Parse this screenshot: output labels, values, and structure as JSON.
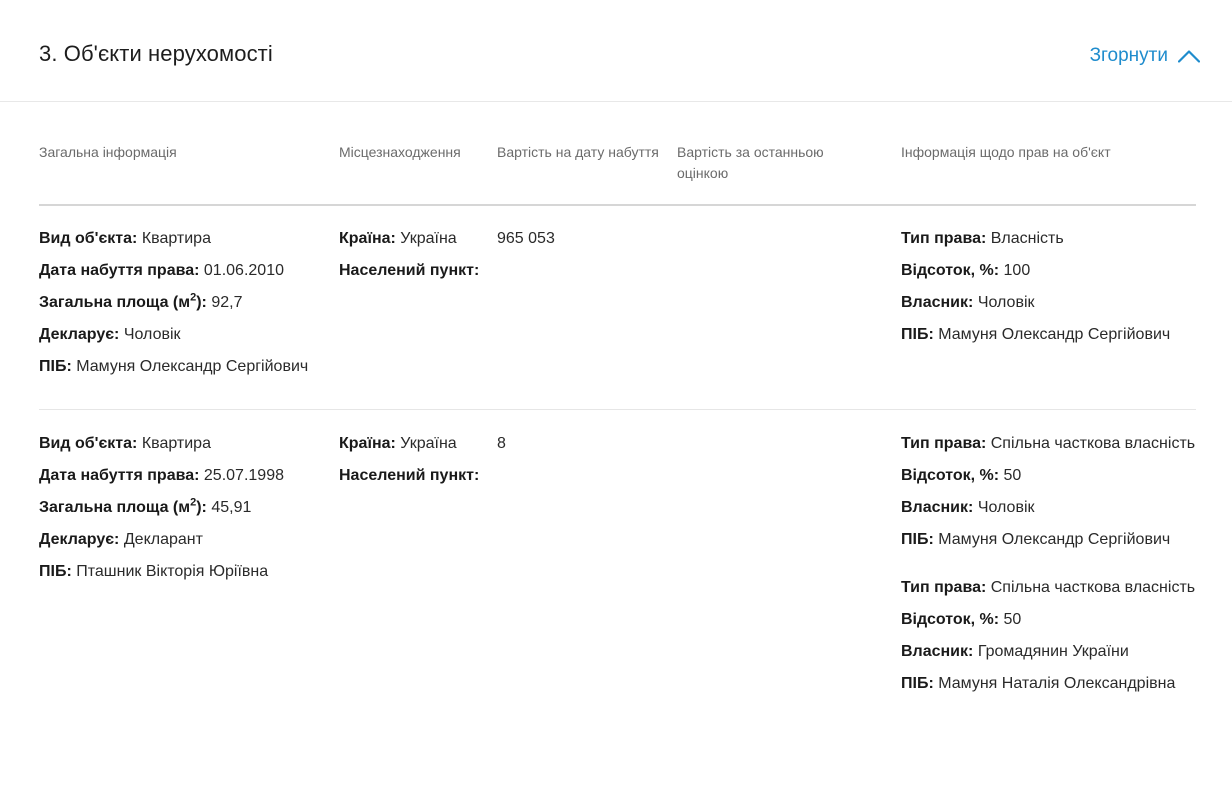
{
  "section": {
    "title": "3. Об'єкти нерухомості",
    "toggle_label": "Згорнути"
  },
  "columns": [
    "Загальна інформація",
    "Місцезнаходження",
    "Вартість на дату набуття",
    "Вартість за останньою оцінкою",
    "Інформація щодо прав на об'єкт"
  ],
  "labels": {
    "object_type": "Вид об'єкта:",
    "acquisition_date": "Дата набуття права:",
    "area_prefix": "Загальна площа (м",
    "area_sup": "2",
    "area_suffix": "):",
    "declares": "Декларує:",
    "full_name": "ПІБ:",
    "country": "Країна:",
    "settlement": "Населений пункт:",
    "right_type": "Тип права:",
    "share": "Відсоток, %:",
    "owner": "Власник:"
  },
  "rows": [
    {
      "object_type": "Квартира",
      "acquisition_date": "01.06.2010",
      "area": "92,7",
      "declares": "Чоловік",
      "full_name": "Мамуня Олександр Сергійович",
      "country": "Україна",
      "settlement": "",
      "value_at_acquisition": "965 053",
      "value_last_assessment": "",
      "rights": [
        {
          "right_type": "Власність",
          "share": "100",
          "owner": "Чоловік",
          "full_name": "Мамуня Олександр Сергійович"
        }
      ]
    },
    {
      "object_type": "Квартира",
      "acquisition_date": "25.07.1998",
      "area": "45,91",
      "declares": "Декларант",
      "full_name": "Пташник Вікторія Юріївна",
      "country": "Україна",
      "settlement": "",
      "value_at_acquisition": "8",
      "value_last_assessment": "",
      "rights": [
        {
          "right_type": "Спільна часткова власність",
          "share": "50",
          "owner": "Чоловік",
          "full_name": "Мамуня Олександр Сергійович"
        },
        {
          "right_type": "Спільна часткова власність",
          "share": "50",
          "owner": "Громадянин України",
          "full_name": "Мамуня Наталія Олександрівна"
        }
      ]
    }
  ],
  "colors": {
    "accent": "#1f8ccd",
    "text": "#1d1d1d",
    "muted": "#6b6b6b"
  },
  "icons": {
    "toggle": "chevron-up-icon"
  }
}
